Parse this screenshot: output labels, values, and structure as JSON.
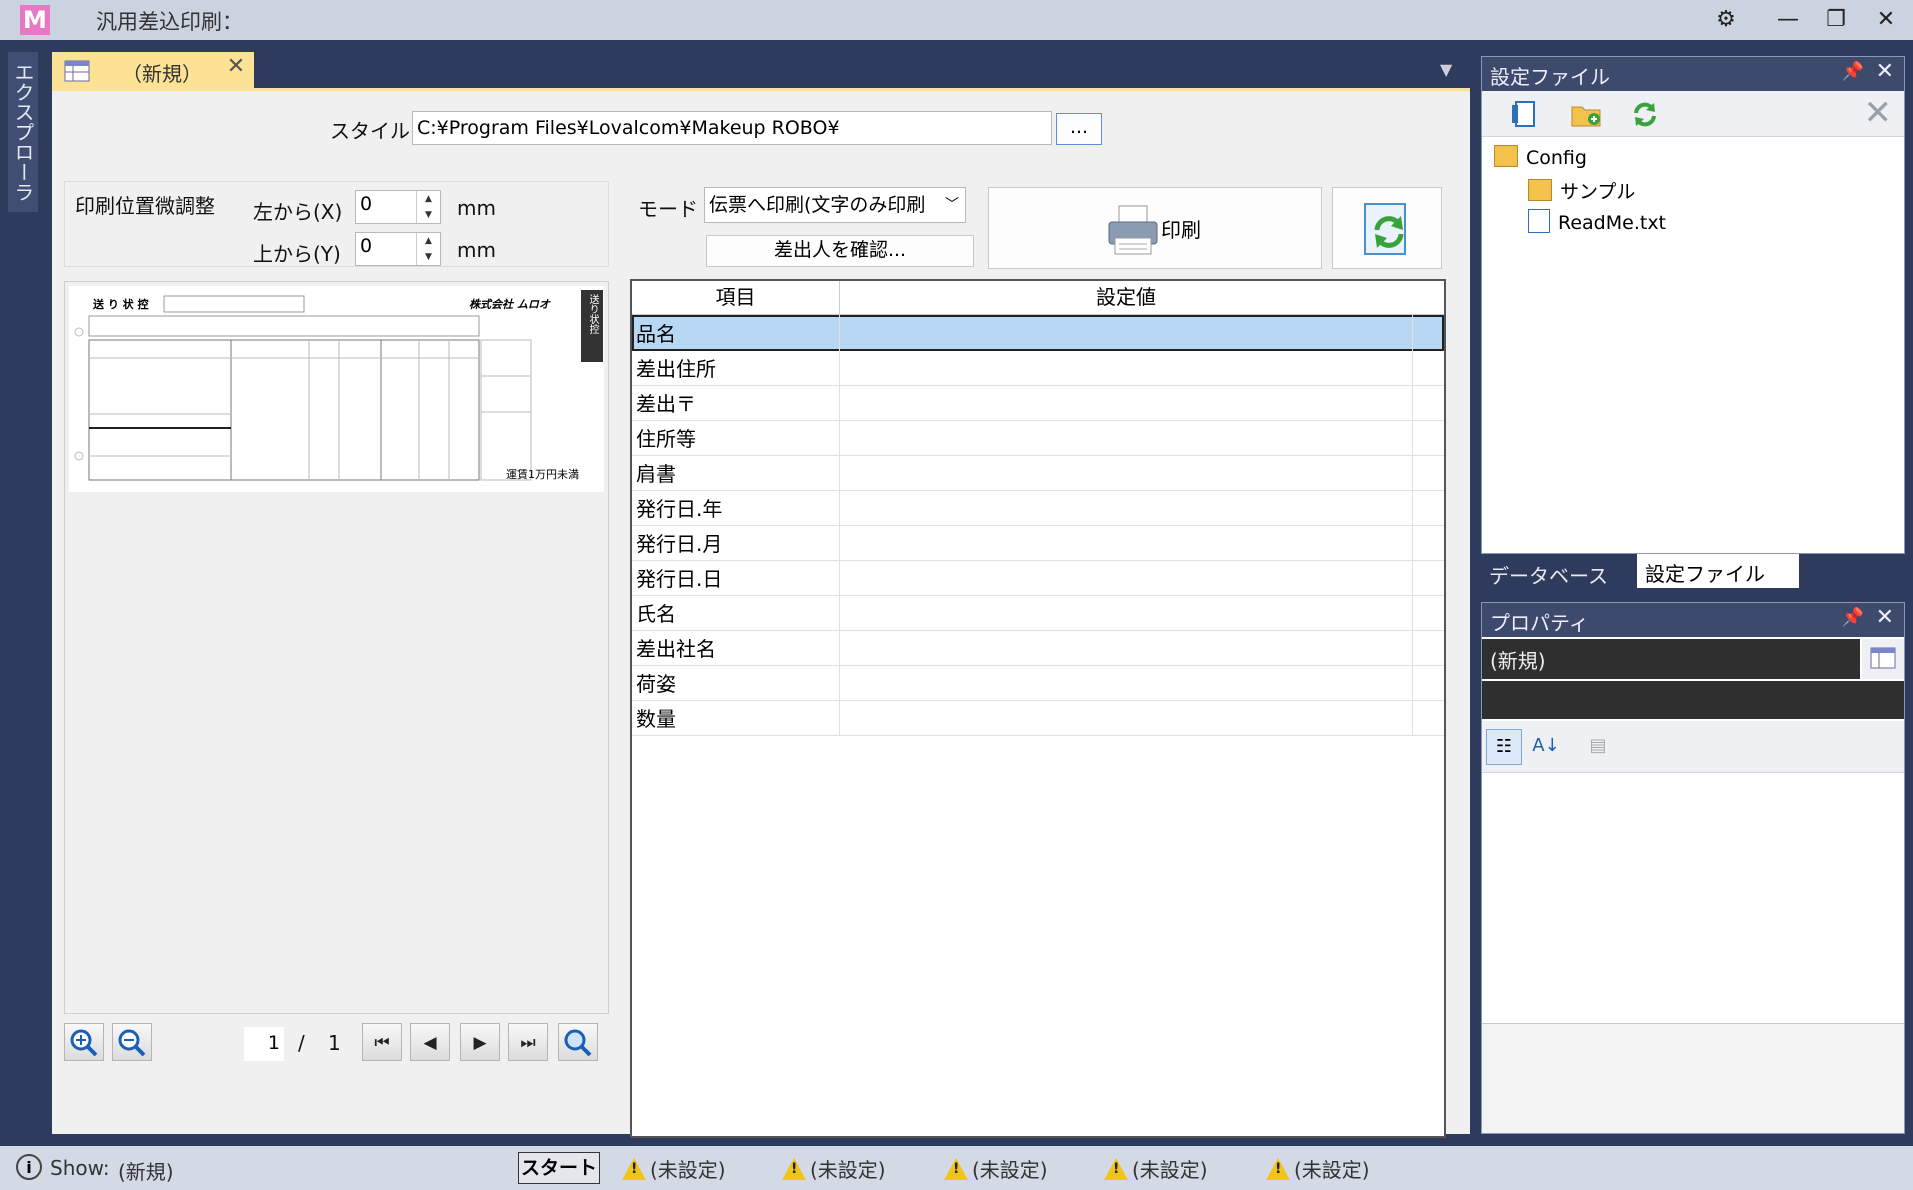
{
  "app": {
    "title": "汎用差込印刷：",
    "logo": "M",
    "controls": {
      "settings": "⚙",
      "minimize": "—",
      "restore": "❐",
      "close": "✕"
    }
  },
  "explorer_strip": {
    "label": "エクスプローラ"
  },
  "doc_tab": {
    "label": "（新規）",
    "close": "✕"
  },
  "style_row": {
    "label": "スタイル",
    "path": "C:¥Program Files¥Lovalcom¥Makeup ROBO¥",
    "browse": "..."
  },
  "adjust": {
    "title": "印刷位置微調整",
    "left_label": "左から(X)",
    "left_value": "0",
    "top_label": "上から(Y)",
    "top_value": "0",
    "unit": "mm"
  },
  "mode": {
    "label": "モード",
    "value": "伝票へ印刷(文字のみ印刷",
    "sender_button": "差出人を確認..."
  },
  "print_button": {
    "label": "印刷"
  },
  "slip": {
    "title": "送 り 状 控",
    "brand": "株式会社 ムロオ",
    "side": "送り状控",
    "note": "運賃1万円未満"
  },
  "preview_nav": {
    "page": "1",
    "sep": "/",
    "total": "1"
  },
  "grid": {
    "headers": [
      "項目",
      "設定値"
    ],
    "rows": [
      "品名",
      "差出住所",
      "差出〒",
      "住所等",
      "肩書",
      "発行日.年",
      "発行日.月",
      "発行日.日",
      "氏名",
      "差出社名",
      "荷姿",
      "数量"
    ],
    "selected_index": 0
  },
  "config_panel": {
    "title": "設定ファイル",
    "pin": "🖈",
    "close": "✕",
    "tree": [
      {
        "label": "Config",
        "level": 0
      },
      {
        "label": "サンプル",
        "level": 1
      },
      {
        "label": "ReadMe.txt",
        "level": 1
      }
    ]
  },
  "panel_tabs": [
    {
      "label": "データベース",
      "active": false
    },
    {
      "label": "設定ファイル",
      "active": true
    }
  ],
  "property_panel": {
    "title": "プロパティ",
    "object_name": "(新規)"
  },
  "statusbar": {
    "show_label": "Show:",
    "show_value": "(新規)",
    "start": "スタート",
    "warnings": [
      "(未設定)",
      "(未設定)",
      "(未設定)",
      "(未設定)",
      "(未設定)"
    ]
  }
}
